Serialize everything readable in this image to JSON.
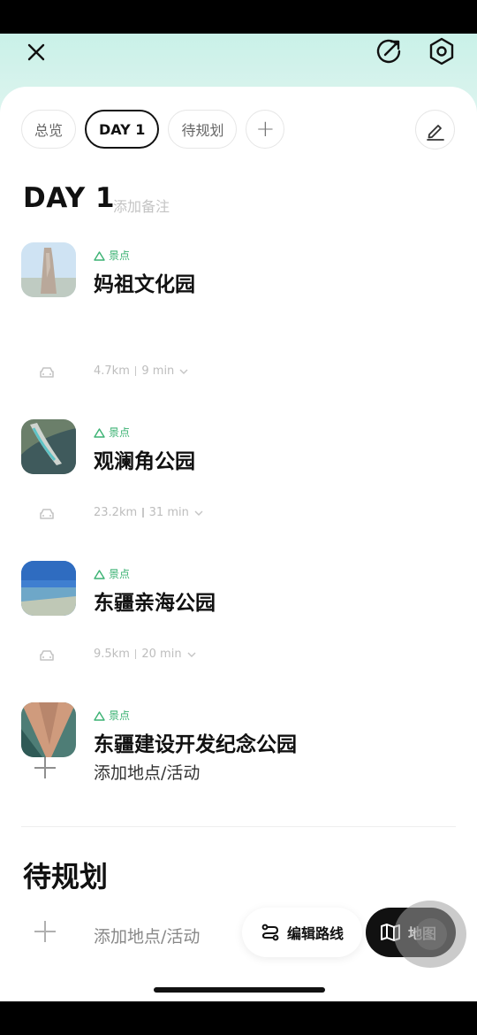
{
  "header": {
    "close_icon": "close-icon",
    "share_icon": "share-arrow-icon",
    "settings_icon": "hexagon-gear-icon"
  },
  "tabs": [
    {
      "label": "总览",
      "active": false
    },
    {
      "label": "DAY 1",
      "active": true
    },
    {
      "label": "待规划",
      "active": false
    }
  ],
  "add_tab_label": "+",
  "day": {
    "title": "DAY 1",
    "note_placeholder": "添加备注"
  },
  "pois": [
    {
      "tag": "景点",
      "name": "妈祖文化园"
    },
    {
      "tag": "景点",
      "name": "观澜角公园"
    },
    {
      "tag": "景点",
      "name": "东疆亲海公园"
    },
    {
      "tag": "景点",
      "name": "东疆建设开发纪念公园"
    }
  ],
  "legs": [
    {
      "distance": "4.7km",
      "time": "9 min"
    },
    {
      "distance": "23.2km",
      "time": "31 min"
    },
    {
      "distance": "9.5km",
      "time": "20 min"
    }
  ],
  "add_place_label": "添加地点/活动",
  "unplanned": {
    "title": "待规划",
    "add_label": "添加地点/活动"
  },
  "actions": {
    "route_label": "编辑路线",
    "map_label": "地图"
  },
  "colors": {
    "accent_green": "#3bb273",
    "header_mint": "#c9f1e8",
    "primary_dark": "#111111"
  }
}
